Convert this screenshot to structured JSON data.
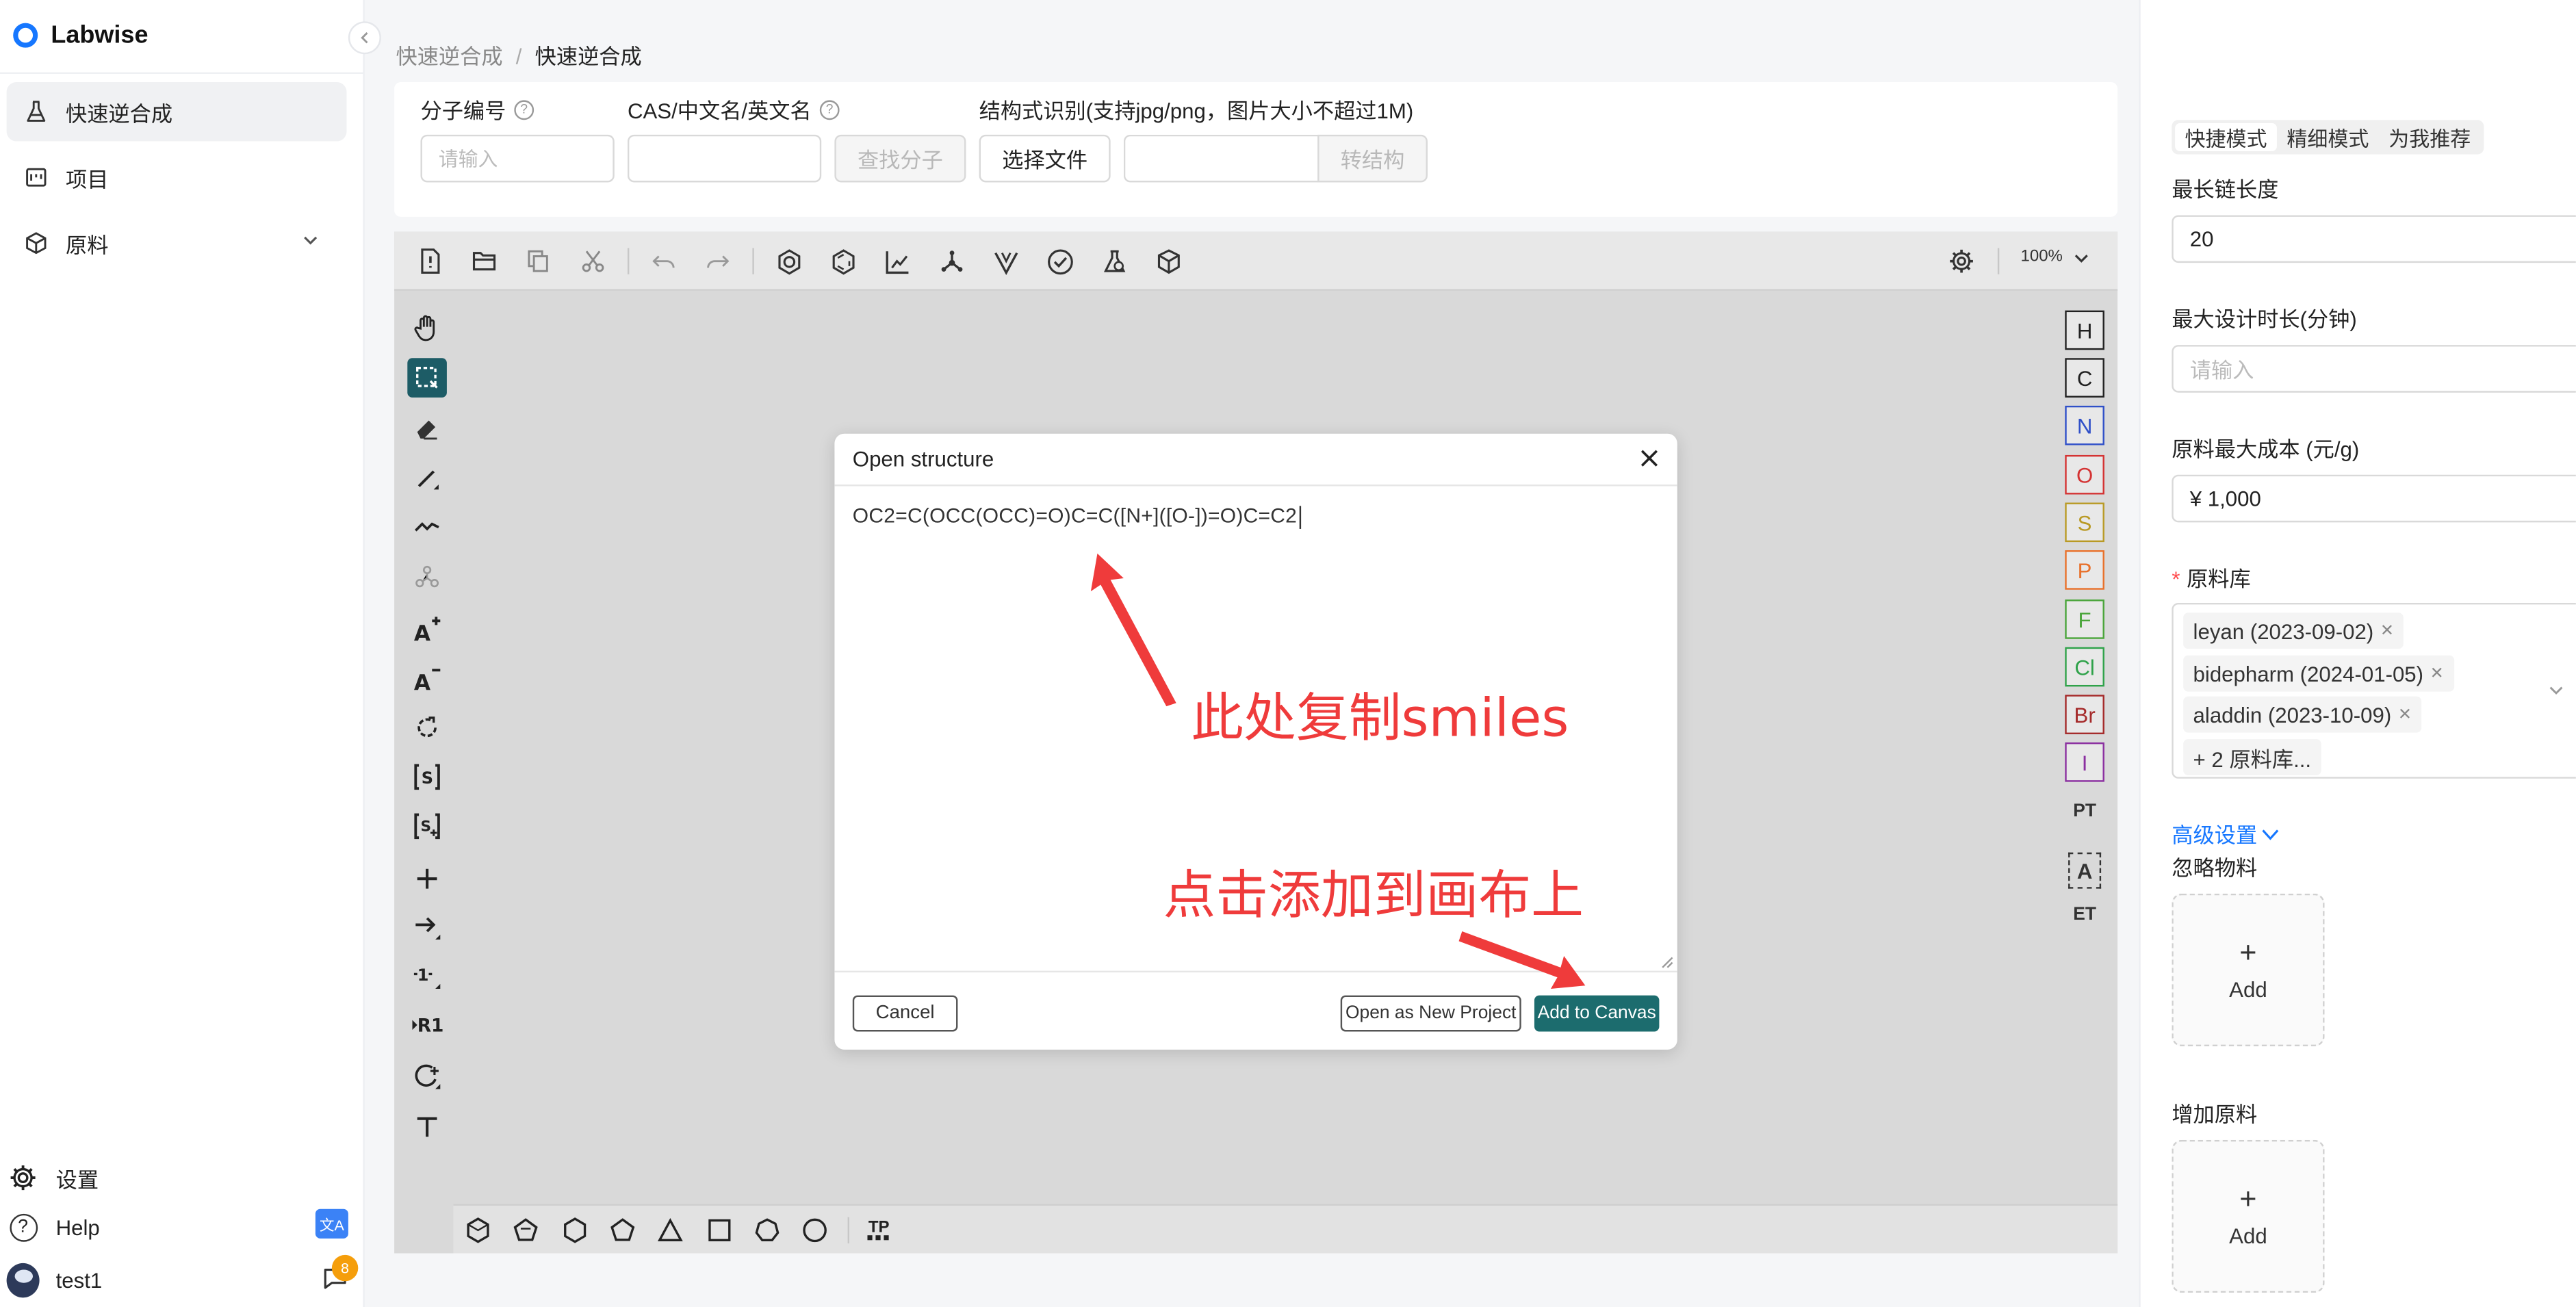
{
  "app": {
    "name": "Labwise",
    "collapse_icon": "chevron-left-icon"
  },
  "sidebar": {
    "items": [
      {
        "label": "快速逆合成",
        "icon": "flask-icon",
        "active": true
      },
      {
        "label": "项目",
        "icon": "project-icon",
        "active": false
      },
      {
        "label": "原料",
        "icon": "cube-icon",
        "active": false
      }
    ],
    "settings_label": "设置",
    "help_label": "Help",
    "user_name": "test1",
    "lang_badge": "文A",
    "notification_count": "8"
  },
  "breadcrumb": {
    "items": [
      "快速逆合成",
      "快速逆合成"
    ],
    "separator": "/"
  },
  "form": {
    "mol_id_label": "分子编号",
    "mol_id_placeholder": "请输入",
    "cas_label": "CAS/中文名/英文名",
    "cas_value": "",
    "find_button": "查找分子",
    "struct_label": "结构式识别(支持jpg/png，图片大小不超过1M)",
    "choose_file_button": "选择文件",
    "file_value": "",
    "convert_button": "转结构"
  },
  "editor": {
    "zoom": "100%",
    "top_toolbar_icons": [
      "new-file-icon",
      "open-folder-icon",
      "copy-icon",
      "cut-icon",
      "undo-icon",
      "redo-icon",
      "aromatize-icon",
      "dearomatize-icon",
      "layout-icon",
      "clean-icon",
      "stereo-icon",
      "check-icon",
      "analyze-icon",
      "3d-view-icon",
      "settings-icon"
    ],
    "left_tools": [
      "hand-icon",
      "select-icon",
      "eraser-icon",
      "bond-icon",
      "chain-icon",
      "template-icon",
      "charge-plus-icon",
      "charge-minus-icon",
      "rotate-icon",
      "sgroup-icon",
      "sgroup-plus-icon",
      "plus-icon",
      "arrow-icon",
      "reaction-map-icon",
      "rgroup-icon",
      "attach-point-icon",
      "text-icon"
    ],
    "atoms": [
      {
        "symbol": "H",
        "color": "#222222"
      },
      {
        "symbol": "C",
        "color": "#222222"
      },
      {
        "symbol": "N",
        "color": "#3050c8"
      },
      {
        "symbol": "O",
        "color": "#d43333"
      },
      {
        "symbol": "S",
        "color": "#b99a25"
      },
      {
        "symbol": "P",
        "color": "#e8702a"
      },
      {
        "symbol": "F",
        "color": "#4aa53a"
      },
      {
        "symbol": "Cl",
        "color": "#2fa24a"
      },
      {
        "symbol": "Br",
        "color": "#a52a2a"
      },
      {
        "symbol": "I",
        "color": "#8b2fa0"
      }
    ],
    "right_text_tools": [
      "PT",
      "A",
      "ET"
    ],
    "bottom_shapes": [
      "cyclohexane-chair-icon",
      "cyclopentane-3d-icon",
      "hexagon-icon",
      "pentagon-icon",
      "triangle-icon",
      "square-icon",
      "heptagon-icon",
      "circle-icon"
    ],
    "template_label": "TP"
  },
  "modal": {
    "title": "Open structure",
    "text": "OC2=C(OCC(OCC)=O)C=C([N+]([O-])=O)C=C2",
    "cancel_button": "Cancel",
    "new_project_button": "Open as New Project",
    "add_button": "Add to Canvas"
  },
  "annotations": {
    "copy_smiles": "此处复制smiles",
    "click_add": "点击添加到画布上",
    "color": "#ef3b3b"
  },
  "right_panel": {
    "modes": [
      "快捷模式",
      "精细模式",
      "为我推荐"
    ],
    "active_mode": "快捷模式",
    "max_chain_label": "最长链长度",
    "max_chain_value": "20",
    "max_time_label": "最大设计时长(分钟)",
    "max_time_placeholder": "请输入",
    "max_cost_label": "原料最大成本 (元/g)",
    "max_cost_value": "¥ 1,000",
    "library_label": "原料库",
    "library_tags": [
      "leyan (2023-09-02)",
      "bidepharm (2024-01-05)",
      "aladdin (2023-10-09)"
    ],
    "library_more": "+ 2 原料库...",
    "advanced_label": "高级设置",
    "ignore_label": "忽略物料",
    "ignore_add": "Add",
    "extra_label": "增加原料",
    "extra_add": "Add"
  },
  "colors": {
    "accent": "#1677ff",
    "editor_primary": "#1c6c6e"
  }
}
